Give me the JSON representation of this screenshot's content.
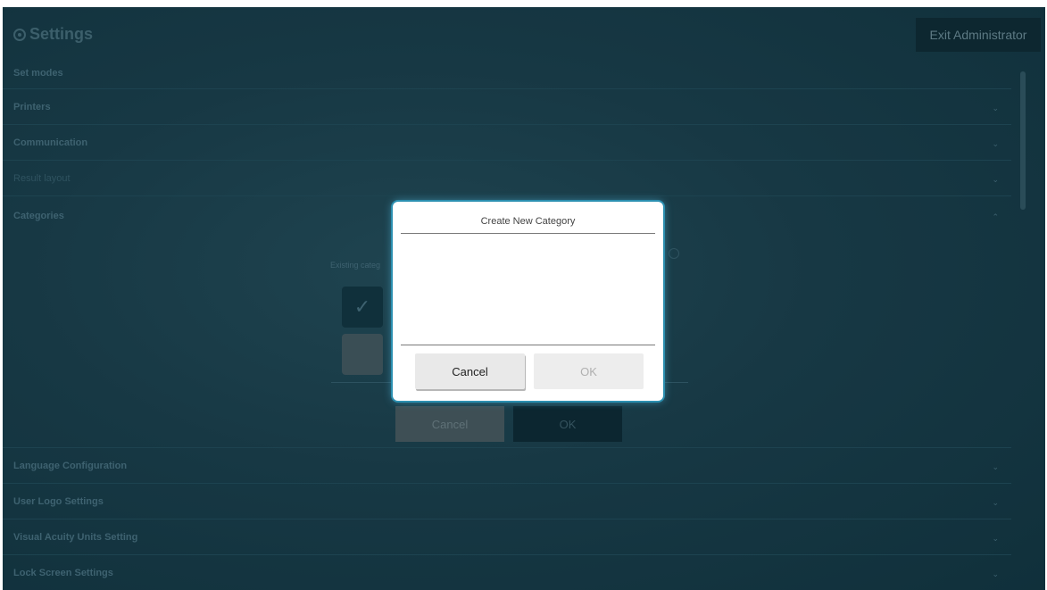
{
  "header": {
    "title": "Settings",
    "exit_label": "Exit Administrator"
  },
  "sections": [
    {
      "label": "Set modes",
      "chevron": "⌄"
    },
    {
      "label": "Printers",
      "chevron": "⌄"
    },
    {
      "label": "Communication",
      "chevron": "⌄"
    },
    {
      "label": "Result layout",
      "chevron": "⌄"
    },
    {
      "label": "Categories",
      "chevron": "⌃"
    },
    {
      "label": "Language Configuration",
      "chevron": "⌄"
    },
    {
      "label": "User Logo Settings",
      "chevron": "⌄"
    },
    {
      "label": "Visual Acuity Units Setting",
      "chevron": "⌄"
    },
    {
      "label": "Lock Screen Settings",
      "chevron": "⌄"
    }
  ],
  "categories_panel": {
    "existing_label": "Existing categ",
    "check_glyph": "✓",
    "cancel_label": "Cancel",
    "ok_label": "OK"
  },
  "dialog": {
    "title": "Create New Category",
    "cancel_label": "Cancel",
    "ok_label": "OK"
  },
  "colors": {
    "accent": "#2b8fb0",
    "background": "#173844"
  }
}
